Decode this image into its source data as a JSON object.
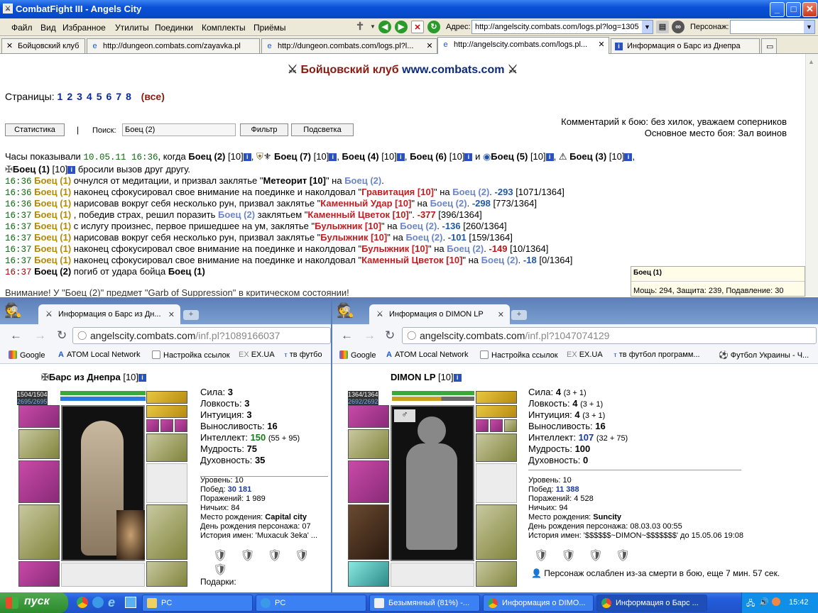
{
  "window": {
    "title": "CombatFight III - Angels City"
  },
  "menu": [
    "Файл",
    "Вид",
    "Избранное",
    "Утилиты",
    "Поединки",
    "Комплекты",
    "Приёмы"
  ],
  "address": {
    "label": "Адрес:",
    "value": "http://angelscity.combats.com/logs.pl?log=1305",
    "persona_label": "Персонаж:"
  },
  "tabs": [
    {
      "label": "Бойцовский клуб"
    },
    {
      "label": "http://dungeon.combats.com/zayavka.pl"
    },
    {
      "label": "http://dungeon.combats.com/logs.pl?l..."
    },
    {
      "label": "http://angelscity.combats.com/logs.pl..."
    },
    {
      "label": "Информация о Барс из Днепра"
    }
  ],
  "page": {
    "site_title": "Бойцовский клуб",
    "site_url": "www.combats.com",
    "pages_label": "Страницы:",
    "pages": [
      "1",
      "2",
      "3",
      "4",
      "5",
      "6",
      "7",
      "8"
    ],
    "all_label": "все",
    "comment": "Комментарий к бою: без хилок, уважаем соперников",
    "place": "Основное место боя: Зал воинов",
    "btn_stats": "Статистика",
    "search_label": "Поиск:",
    "search_value": "Боец (2)",
    "btn_filter": "Фильтр",
    "btn_highlight": "Подсветка",
    "tooltip_name": "Боец (1)",
    "tooltip_stats": "Мощь: 294, Защита: 239, Подавление: 30"
  },
  "log": {
    "intro_a": "Часы показывали",
    "intro_time": "10.05.11 16:36",
    "intro_b": ", когда",
    "fighters": [
      "Боец (2)",
      "Боец (7)",
      "Боец (4)",
      "Боец (6)",
      "Боец (5)",
      "Боец (3)",
      "Боец (1)"
    ],
    "lvl": "[10]",
    "and": "и",
    "challenge": "бросили вызов друг другу.",
    "lines": [
      {
        "time": "16:36",
        "who": "Боец (1)",
        "a": "очнулся от медитации, и призвал заклятье \"",
        "spell": "Метеорит [10]",
        "b": "\" на ",
        "target": "Боец (2)",
        "c": ".",
        "dmg": "",
        "hp": "",
        "spell_style": "black"
      },
      {
        "time": "16:36",
        "who": "Боец (1)",
        "a": "наконец сфокусировал свое внимание на поединке и наколдовал \"",
        "spell": "Гравитация [10]",
        "b": "\" на ",
        "target": "Боец (2)",
        "c": ".",
        "dmg": "-293",
        "hp": "[1071/1364]",
        "spell_style": "red"
      },
      {
        "time": "16:36",
        "who": "Боец (1)",
        "a": "нарисовав вокруг себя несколько рун, призвал заклятье \"",
        "spell": "Каменный Удар [10]",
        "b": "\" на ",
        "target": "Боец (2)",
        "c": ".",
        "dmg": "-298",
        "hp": "[773/1364]",
        "spell_style": "red"
      },
      {
        "time": "16:37",
        "who": "Боец (1)",
        "a": ", победив страх, решил поразить ",
        "spell": "Каменный Цветок [10]",
        "b": " заклятьем \"",
        "target": "Боец (2)",
        "c": "\".",
        "dmg": "-377",
        "hp": "[396/1364]",
        "spell_style": "red",
        "order": "target-first"
      },
      {
        "time": "16:37",
        "who": "Боец (1)",
        "a": "с иcлугу произнес, первое пришедшее на ум, заклятье \"",
        "spell": "Булыжник [10]",
        "b": "\" на ",
        "target": "Боец (2)",
        "c": ".",
        "dmg": "-136",
        "hp": "[260/1364]",
        "spell_style": "red"
      },
      {
        "time": "16:37",
        "who": "Боец (1)",
        "a": "нарисовав вокруг себя несколько рун, призвал заклятье \"",
        "spell": "Булыжник [10]",
        "b": "\" на ",
        "target": "Боец (2)",
        "c": ".",
        "dmg": "-101",
        "hp": "[159/1364]",
        "spell_style": "red"
      },
      {
        "time": "16:37",
        "who": "Боец (1)",
        "a": "наконец сфокусировал свое внимание на поединке и наколдовал \"",
        "spell": "Булыжник [10]",
        "b": "\" на ",
        "target": "Боец (2)",
        "c": ".",
        "dmg": "-149",
        "hp": "[10/1364]",
        "spell_style": "red"
      },
      {
        "time": "16:37",
        "who": "Боец (1)",
        "a": "наконец сфокусировал свое внимание на поединке и наколдовал \"",
        "spell": "Каменный Цветок [10]",
        "b": "\" на ",
        "target": "Боец (2)",
        "c": ".",
        "dmg": "-18",
        "hp": "[0/1364]",
        "spell_style": "red"
      }
    ],
    "death_time": "16:37",
    "death_who": "Боец (2)",
    "death_text": "погиб от удара бойца",
    "death_by": "Боец (1)",
    "cut_line": "Внимание! У \"Боец (2)\" предмет \"Garb of Suppression\" в критическом состоянии!"
  },
  "win1": {
    "tab": "Информация о Барс из Дн...",
    "url_host": "angelscity.combats.com",
    "url_path": "/inf.pl?1089166037",
    "bookmarks": [
      "Google",
      "ATOM Local Network",
      "Настройка ссылок",
      "EX.UA",
      "тв футбо"
    ],
    "name": "Барс из Днепра",
    "level_tag": "[10]",
    "hp": "1504/1504",
    "mana": "2695/2695",
    "stats": [
      {
        "label": "Сила:",
        "value": "3",
        "extra": ""
      },
      {
        "label": "Ловкость:",
        "value": "3",
        "extra": ""
      },
      {
        "label": "Интуиция:",
        "value": "3",
        "extra": ""
      },
      {
        "label": "Выносливость:",
        "value": "16",
        "extra": ""
      },
      {
        "label": "Интеллект:",
        "value": "150",
        "extra": "(55 + 95)"
      },
      {
        "label": "Мудрость:",
        "value": "75",
        "extra": ""
      },
      {
        "label": "Духовность:",
        "value": "35",
        "extra": ""
      }
    ],
    "info": [
      {
        "label": "Уровень:",
        "value": "10"
      },
      {
        "label": "Побед:",
        "value": "30 181"
      },
      {
        "label": "Поражений:",
        "value": "1 989"
      },
      {
        "label": "Ничьих:",
        "value": "84"
      },
      {
        "label": "Место рождения:",
        "value": "Capital city"
      },
      {
        "label": "День рождения персонажа:",
        "value": "07"
      },
      {
        "label": "История имен:",
        "value": "'Muxacuk 3eka' ..."
      }
    ],
    "gifts_label": "Подарки:"
  },
  "win2": {
    "tab": "Информация о DIMON LP",
    "url_host": "angelscity.combats.com",
    "url_path": "/inf.pl?1047074129",
    "bookmarks": [
      "Google",
      "ATOM Local Network",
      "Настройка ссылок",
      "EX.UA",
      "тв футбол программ...",
      "Футбол Украины - Ч..."
    ],
    "name": "DIMON LP",
    "level_tag": "[10]",
    "hp": "1364/1364",
    "mana": "2692/2692",
    "stats": [
      {
        "label": "Сила:",
        "value": "4",
        "extra": "(3 + 1)"
      },
      {
        "label": "Ловкость:",
        "value": "4",
        "extra": "(3 + 1)"
      },
      {
        "label": "Интуиция:",
        "value": "4",
        "extra": "(3 + 1)"
      },
      {
        "label": "Выносливость:",
        "value": "16",
        "extra": ""
      },
      {
        "label": "Интеллект:",
        "value": "107",
        "extra": "(32 + 75)"
      },
      {
        "label": "Мудрость:",
        "value": "100",
        "extra": ""
      },
      {
        "label": "Духовность:",
        "value": "0",
        "extra": ""
      }
    ],
    "info": [
      {
        "label": "Уровень:",
        "value": "10"
      },
      {
        "label": "Побед:",
        "value": "11 388"
      },
      {
        "label": "Поражений:",
        "value": "4 528"
      },
      {
        "label": "Ничьих:",
        "value": "94"
      },
      {
        "label": "Место рождения:",
        "value": "Suncity"
      },
      {
        "label": "День рождения персонажа:",
        "value": "08.03.03 00:55"
      },
      {
        "label": "История имен:",
        "value": "'$$$$$$~DIMON~$$$$$$$' до 15.05.06 19:08"
      }
    ],
    "weakened": "Персонаж ослаблен из-за смерти в бою, еще 7 мин. 57 сек."
  },
  "taskbar": {
    "start": "пуск",
    "items": [
      "PC",
      "PC",
      "Безымянный (81%) -...",
      "Информация о DIMO...",
      "Информация о Барс ..."
    ],
    "clock": "15:42"
  }
}
